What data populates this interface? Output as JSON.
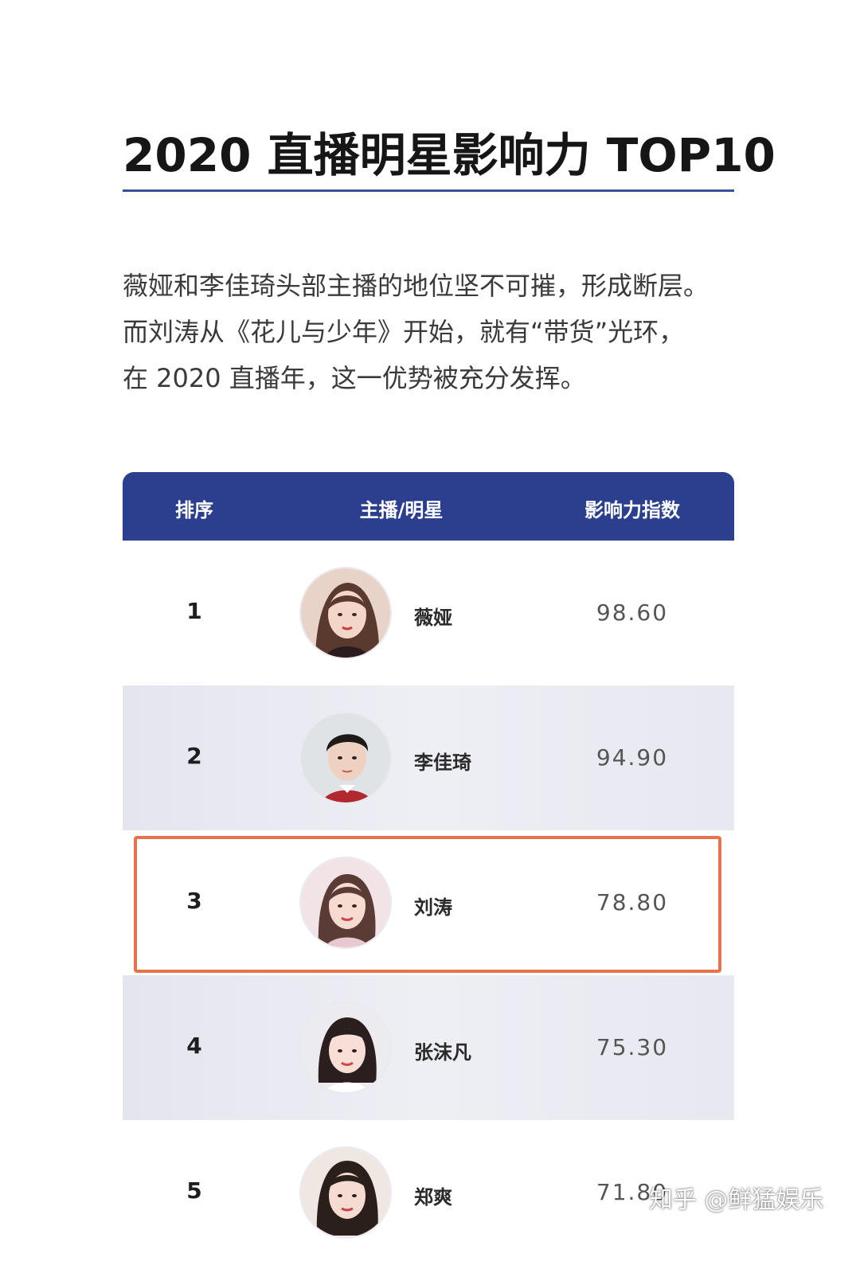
{
  "title": "2020 直播明星影响力 TOP10",
  "intro": {
    "lines": [
      "薇娅和李佳琦头部主播的地位坚不可摧，形成断层。",
      "而刘涛从《花儿与少年》开始，就有“带货”光环，",
      "在 2020 直播年，这一优势被充分发挥。"
    ]
  },
  "table": {
    "headers": {
      "rank": "排序",
      "name": "主播/明星",
      "score": "影响力指数"
    },
    "rows": [
      {
        "rank": "1",
        "name": "薇娅",
        "score": "98.60",
        "avatar_icon": "portrait-woman-icon"
      },
      {
        "rank": "2",
        "name": "李佳琦",
        "score": "94.90",
        "avatar_icon": "portrait-man-icon"
      },
      {
        "rank": "3",
        "name": "刘涛",
        "score": "78.80",
        "avatar_icon": "portrait-woman-icon"
      },
      {
        "rank": "4",
        "name": "张沫凡",
        "score": "75.30",
        "avatar_icon": "portrait-woman-icon"
      },
      {
        "rank": "5",
        "name": "郑爽",
        "score": "71.80",
        "avatar_icon": "portrait-woman-icon"
      }
    ],
    "highlighted_rank": "3"
  },
  "watermark": "知乎 @鲜猛娱乐",
  "colors": {
    "header_bg": "#2b3f8e",
    "rule": "#3a4f9a",
    "highlight_border": "#e8734a"
  }
}
